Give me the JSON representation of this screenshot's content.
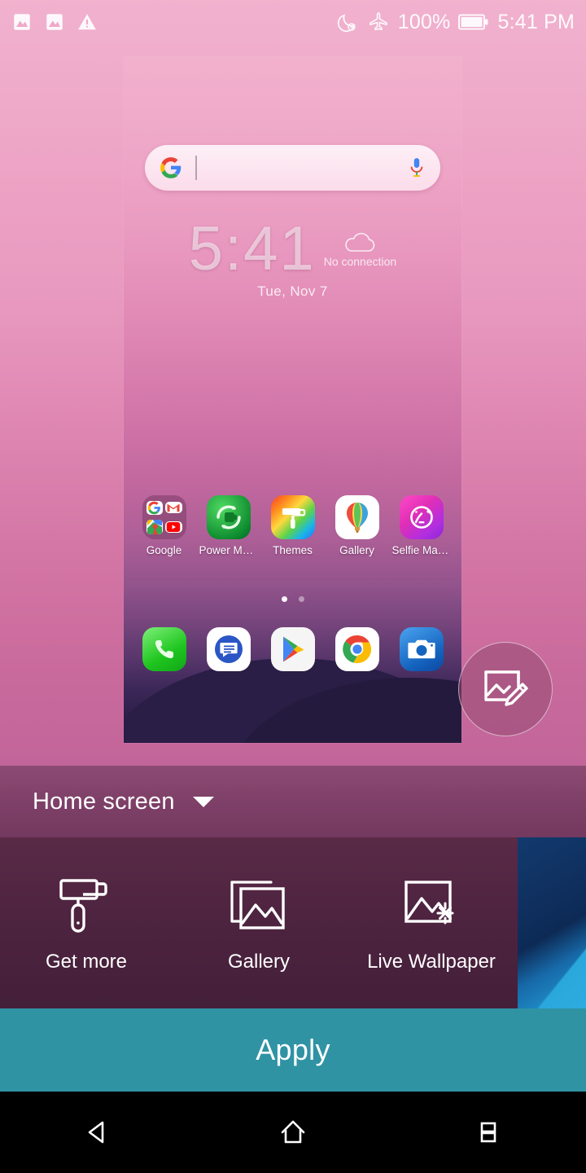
{
  "status_bar": {
    "left_icons": [
      {
        "name": "image-notification-icon"
      },
      {
        "name": "image-notification-icon"
      },
      {
        "name": "warning-triangle-icon"
      }
    ],
    "right_icons": [
      {
        "name": "do-not-disturb-moon-icon"
      },
      {
        "name": "airplane-mode-icon"
      }
    ],
    "battery_percent": "100%",
    "battery_icon": "battery-full-icon",
    "time": "5:41 PM"
  },
  "preview": {
    "search": {
      "logo_icon": "google-g-logo-icon",
      "mic_icon": "microphone-icon",
      "placeholder": ""
    },
    "clock": {
      "time": "5:41",
      "date": "Tue, Nov 7",
      "weather_icon": "cloud-icon",
      "weather_status": "No connection"
    },
    "apps": [
      {
        "label": "Google",
        "icon": "google-folder-icon"
      },
      {
        "label": "Power Ma...",
        "icon": "power-master-icon"
      },
      {
        "label": "Themes",
        "icon": "themes-icon"
      },
      {
        "label": "Gallery",
        "icon": "gallery-balloon-icon"
      },
      {
        "label": "Selfie Mas...",
        "icon": "selfie-master-icon"
      }
    ],
    "dock": [
      {
        "label": "Phone",
        "icon": "phone-icon"
      },
      {
        "label": "Messages",
        "icon": "messages-icon"
      },
      {
        "label": "Play Store",
        "icon": "play-store-icon"
      },
      {
        "label": "Chrome",
        "icon": "chrome-icon"
      },
      {
        "label": "Camera",
        "icon": "camera-icon"
      }
    ],
    "page_dots": {
      "count": 2,
      "active_index": 0
    },
    "edit_button_icon": "image-edit-icon"
  },
  "selector": {
    "label": "Home screen",
    "caret_icon": "chevron-down-icon"
  },
  "options": [
    {
      "label": "Get more",
      "icon": "paint-roller-icon"
    },
    {
      "label": "Gallery",
      "icon": "photo-stack-icon"
    },
    {
      "label": "Live Wallpaper",
      "icon": "live-wallpaper-icon"
    }
  ],
  "wallpaper_thumbnail": {
    "name": "wallpaper-thumbnail-blue"
  },
  "apply": {
    "label": "Apply",
    "color": "#2f93a4"
  },
  "nav_bar": {
    "back_icon": "back-triangle-icon",
    "home_icon": "home-house-icon",
    "recents_icon": "recents-split-icon"
  }
}
